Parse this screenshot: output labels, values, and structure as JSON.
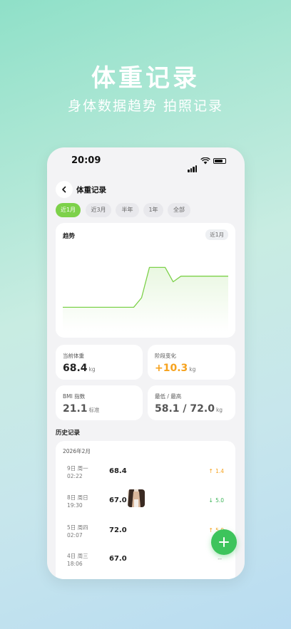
{
  "hero": {
    "title": "体重记录",
    "subtitle": "身体数据趋势 拍照记录"
  },
  "status_bar": {
    "time": "20:09"
  },
  "nav": {
    "title": "体重记录"
  },
  "periods": [
    {
      "label": "近1月",
      "active": true
    },
    {
      "label": "近3月",
      "active": false
    },
    {
      "label": "半年",
      "active": false
    },
    {
      "label": "1年",
      "active": false
    },
    {
      "label": "全部",
      "active": false
    }
  ],
  "trend": {
    "title": "趋势",
    "badge": "近1月"
  },
  "chart_data": {
    "type": "area",
    "series": [
      {
        "values": [
          67.0,
          67.0,
          67.0,
          67.0,
          67.0,
          67.0,
          67.0,
          67.0,
          67.0,
          67.0,
          68.2,
          72.0,
          72.0,
          72.0,
          70.2,
          70.9,
          70.9,
          70.9,
          70.9,
          70.9,
          70.9,
          70.9
        ]
      }
    ],
    "ylim": [
      64,
      74
    ],
    "color": "#7dd14a",
    "fill_color": "#e9f7e1",
    "grid": false
  },
  "stats": {
    "current": {
      "label": "当前体重",
      "value": "68.4",
      "unit": "kg"
    },
    "change": {
      "label": "阶段变化",
      "value": "+10.3",
      "unit": "kg"
    },
    "bmi": {
      "label": "BMI 指数",
      "value": "21.1",
      "unit": "标准"
    },
    "range": {
      "label": "最低 / 最高",
      "value": "58.1 / 72.0",
      "unit": "kg"
    }
  },
  "history": {
    "title": "历史记录",
    "month": "2026年2月",
    "rows": [
      {
        "day": "9日 周一",
        "time": "02:22",
        "weight": "68.4",
        "arrow": "↑",
        "change": "1.4",
        "dir": "up",
        "photo": false
      },
      {
        "day": "8日 周日",
        "time": "19:30",
        "weight": "67.0",
        "arrow": "↓",
        "change": "5.0",
        "dir": "down",
        "photo": true
      },
      {
        "day": "5日 周四",
        "time": "02:07",
        "weight": "72.0",
        "arrow": "↑",
        "change": "5.0",
        "dir": "up",
        "photo": false
      },
      {
        "day": "4日 周三",
        "time": "18:06",
        "weight": "67.0",
        "arrow": "--",
        "change": "",
        "dir": "flat",
        "photo": false
      }
    ]
  },
  "fab": {
    "label": "+"
  },
  "colors": {
    "accent": "#7dd14a",
    "fab": "#3dc45c",
    "up": "#f6a21d",
    "down": "#3fb55a"
  },
  "icons": {
    "back": "chevron-left-icon",
    "signal": "signal-icon",
    "wifi": "wifi-icon",
    "battery": "battery-icon",
    "add": "plus-icon"
  }
}
